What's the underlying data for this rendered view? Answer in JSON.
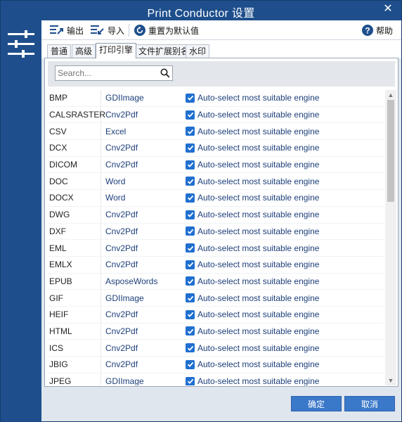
{
  "window": {
    "title": "Print Conductor 设置",
    "close_glyph": "✕"
  },
  "toolbar": {
    "export_label": "输出",
    "import_label": "导入",
    "reset_label": "重置为默认值",
    "help_label": "帮助"
  },
  "tabs": [
    {
      "label": "普通"
    },
    {
      "label": "高级"
    },
    {
      "label": "打印引擎",
      "active": true
    },
    {
      "label": "文件扩展别名"
    },
    {
      "label": "水印"
    }
  ],
  "search": {
    "placeholder": "Search..."
  },
  "engines": [
    {
      "ext": "BMP",
      "engine": "GDIImage",
      "auto": "Auto-select most suitable engine",
      "checked": true
    },
    {
      "ext": "CALSRASTER",
      "engine": "Cnv2Pdf",
      "auto": "Auto-select most suitable engine",
      "checked": true
    },
    {
      "ext": "CSV",
      "engine": "Excel",
      "auto": "Auto-select most suitable engine",
      "checked": true
    },
    {
      "ext": "DCX",
      "engine": "Cnv2Pdf",
      "auto": "Auto-select most suitable engine",
      "checked": true
    },
    {
      "ext": "DICOM",
      "engine": "Cnv2Pdf",
      "auto": "Auto-select most suitable engine",
      "checked": true
    },
    {
      "ext": "DOC",
      "engine": "Word",
      "auto": "Auto-select most suitable engine",
      "checked": true
    },
    {
      "ext": "DOCX",
      "engine": "Word",
      "auto": "Auto-select most suitable engine",
      "checked": true
    },
    {
      "ext": "DWG",
      "engine": "Cnv2Pdf",
      "auto": "Auto-select most suitable engine",
      "checked": true
    },
    {
      "ext": "DXF",
      "engine": "Cnv2Pdf",
      "auto": "Auto-select most suitable engine",
      "checked": true
    },
    {
      "ext": "EML",
      "engine": "Cnv2Pdf",
      "auto": "Auto-select most suitable engine",
      "checked": true
    },
    {
      "ext": "EMLX",
      "engine": "Cnv2Pdf",
      "auto": "Auto-select most suitable engine",
      "checked": true
    },
    {
      "ext": "EPUB",
      "engine": "AsposeWords",
      "auto": "Auto-select most suitable engine",
      "checked": true
    },
    {
      "ext": "GIF",
      "engine": "GDIImage",
      "auto": "Auto-select most suitable engine",
      "checked": true
    },
    {
      "ext": "HEIF",
      "engine": "Cnv2Pdf",
      "auto": "Auto-select most suitable engine",
      "checked": true
    },
    {
      "ext": "HTML",
      "engine": "Cnv2Pdf",
      "auto": "Auto-select most suitable engine",
      "checked": true
    },
    {
      "ext": "ICS",
      "engine": "Cnv2Pdf",
      "auto": "Auto-select most suitable engine",
      "checked": true
    },
    {
      "ext": "JBIG",
      "engine": "Cnv2Pdf",
      "auto": "Auto-select most suitable engine",
      "checked": true
    },
    {
      "ext": "JPEG",
      "engine": "GDIImage",
      "auto": "Auto-select most suitable engine",
      "checked": true
    }
  ],
  "footer": {
    "ok_label": "确定",
    "cancel_label": "取消"
  },
  "colors": {
    "title_bar": "#1e4f8c",
    "accent_button": "#3a78c9",
    "checkbox": "#1f6fd0",
    "engine_text": "#1d3f7a"
  }
}
